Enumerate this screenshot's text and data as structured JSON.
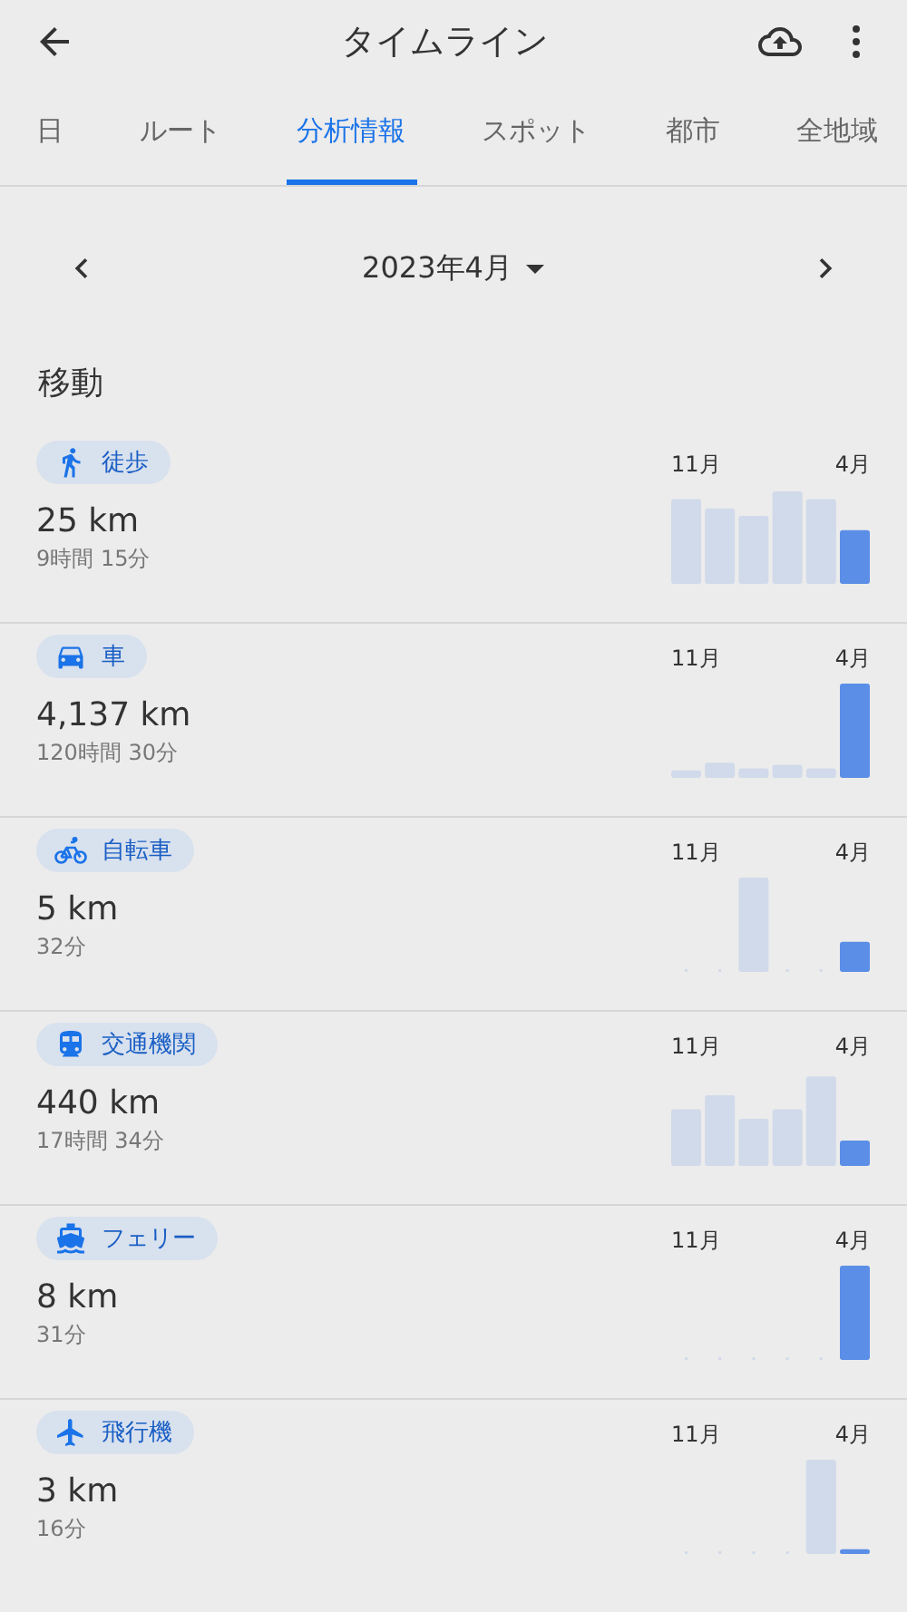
{
  "app_bar": {
    "title": "タイムライン"
  },
  "tabs": [
    {
      "label": "日",
      "selected": false
    },
    {
      "label": "ルート",
      "selected": false
    },
    {
      "label": "分析情報",
      "selected": true
    },
    {
      "label": "スポット",
      "selected": false
    },
    {
      "label": "都市",
      "selected": false
    },
    {
      "label": "全地域",
      "selected": false
    }
  ],
  "month_picker": {
    "label": "2023年4月"
  },
  "section_title": "移動",
  "activities": [
    {
      "kind": "walk",
      "label": "徒歩",
      "distance": "25 km",
      "duration": "9時間 15分",
      "chart_start": "11月",
      "chart_end": "4月"
    },
    {
      "kind": "car",
      "label": "車",
      "distance": "4,137 km",
      "duration": "120時間 30分",
      "chart_start": "11月",
      "chart_end": "4月"
    },
    {
      "kind": "bike",
      "label": "自転車",
      "distance": "5 km",
      "duration": "32分",
      "chart_start": "11月",
      "chart_end": "4月"
    },
    {
      "kind": "transit",
      "label": "交通機関",
      "distance": "440 km",
      "duration": "17時間 34分",
      "chart_start": "11月",
      "chart_end": "4月"
    },
    {
      "kind": "ferry",
      "label": "フェリー",
      "distance": "8 km",
      "duration": "31分",
      "chart_start": "11月",
      "chart_end": "4月"
    },
    {
      "kind": "plane",
      "label": "飛行機",
      "distance": "3 km",
      "duration": "16分",
      "chart_start": "11月",
      "chart_end": "4月"
    }
  ]
}
